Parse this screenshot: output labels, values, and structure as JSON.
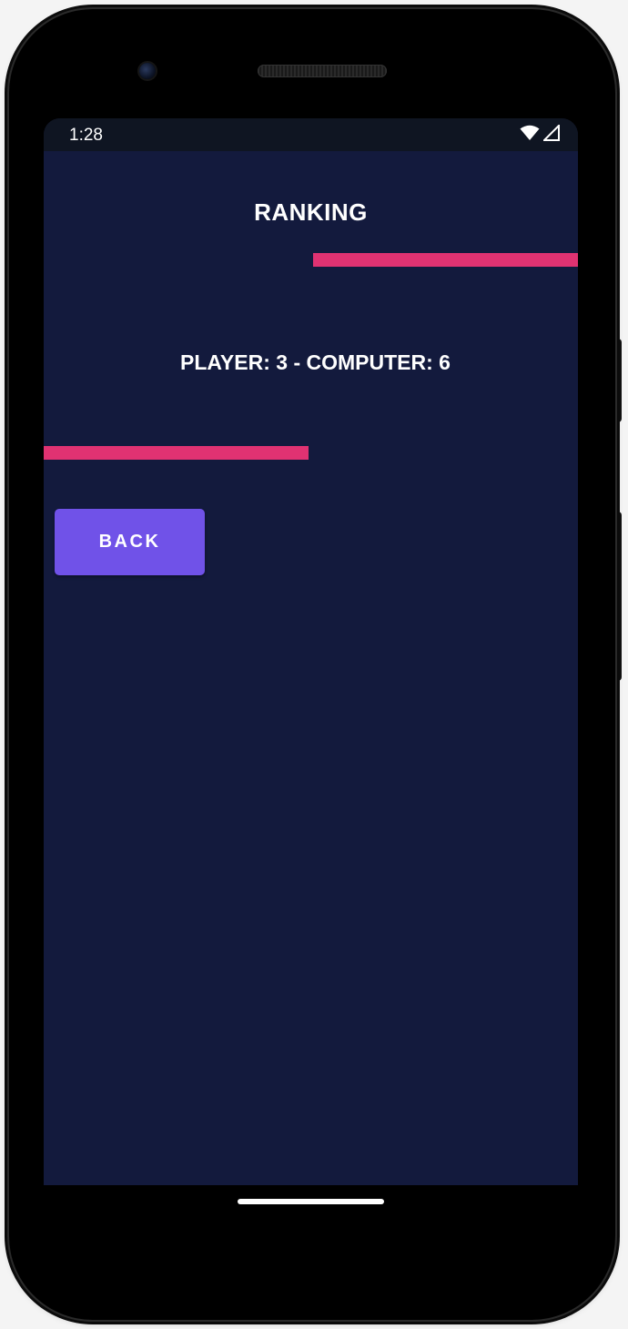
{
  "status_bar": {
    "time": "1:28",
    "icons": [
      "wifi-icon",
      "cell-signal-icon"
    ]
  },
  "screen": {
    "title": "RANKING",
    "score_text": "PLAYER: 3 - COMPUTER: 6",
    "back_label": "BACK"
  },
  "colors": {
    "background": "#131a3d",
    "accent_bar": "#e03272",
    "button": "#7052e8",
    "text": "#ffffff"
  }
}
